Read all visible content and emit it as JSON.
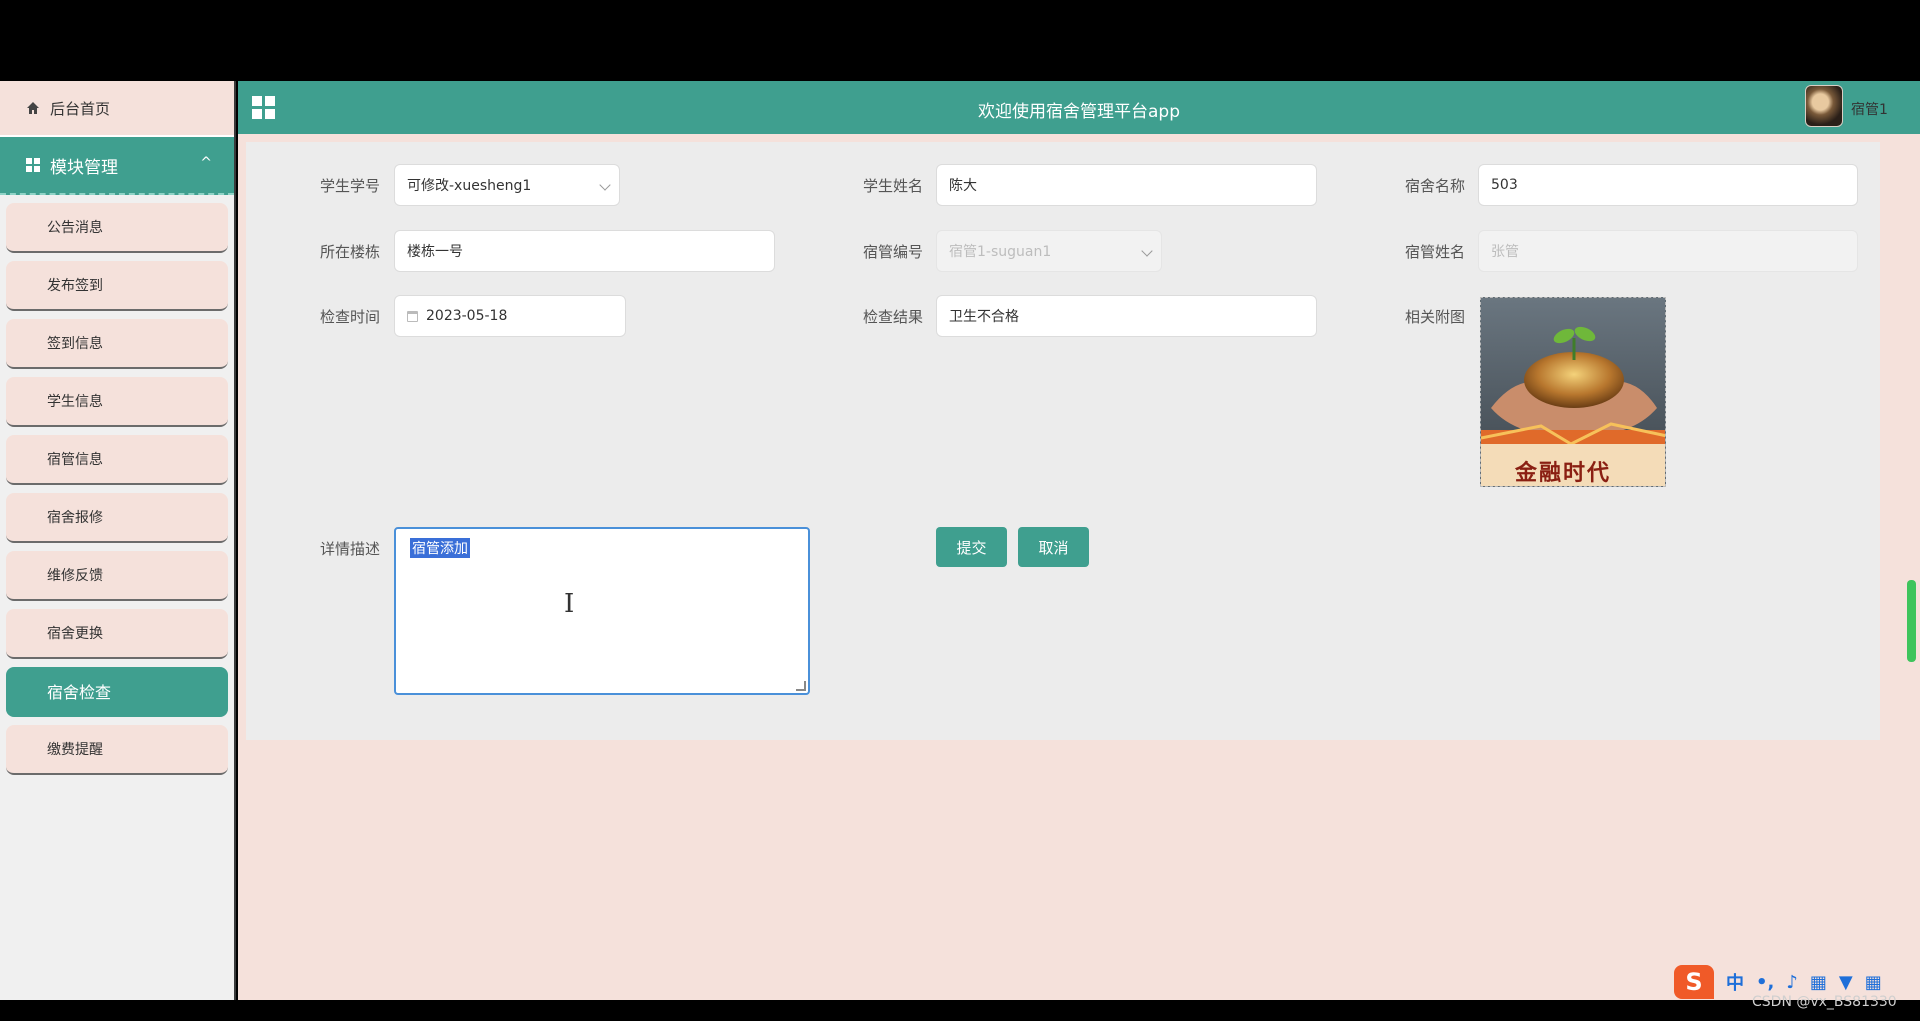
{
  "app": {
    "title": "欢迎使用宿舍管理平台app",
    "user": "宿管1"
  },
  "sidebar": {
    "home": "后台首页",
    "module": "模块管理",
    "items": [
      {
        "label": "公告消息"
      },
      {
        "label": "发布签到"
      },
      {
        "label": "签到信息"
      },
      {
        "label": "学生信息"
      },
      {
        "label": "宿管信息"
      },
      {
        "label": "宿舍报修"
      },
      {
        "label": "维修反馈"
      },
      {
        "label": "宿舍更换"
      },
      {
        "label": "宿舍检查",
        "active": true
      },
      {
        "label": "缴费提醒"
      }
    ]
  },
  "form": {
    "student_id": {
      "label": "学生学号",
      "value": "可修改-xuesheng1"
    },
    "student_name": {
      "label": "学生姓名",
      "value": "陈大"
    },
    "dorm_name": {
      "label": "宿舍名称",
      "value": "503"
    },
    "building": {
      "label": "所在楼栋",
      "value": "楼栋一号"
    },
    "manager_id": {
      "label": "宿管编号",
      "value": "宿管1-suguan1"
    },
    "manager_name": {
      "label": "宿管姓名",
      "value": "张管"
    },
    "check_time": {
      "label": "检查时间",
      "value": "2023-05-18"
    },
    "check_result": {
      "label": "检查结果",
      "value": "卫生不合格"
    },
    "photo": {
      "label": "相关附图",
      "caption": "金融时代"
    },
    "detail": {
      "label": "详情描述",
      "value": "宿管添加"
    },
    "submit": "提交",
    "cancel": "取消"
  },
  "ime": {
    "logo": "S",
    "mode": "中"
  },
  "watermark": "CSDN @vx_BS81330"
}
